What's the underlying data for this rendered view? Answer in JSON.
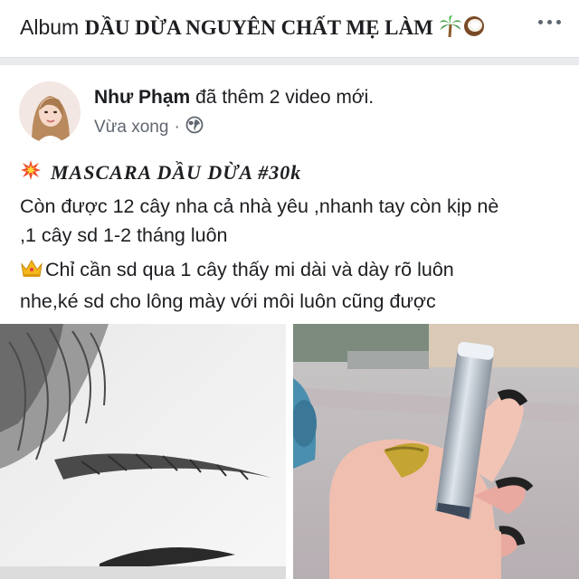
{
  "header": {
    "album_prefix": "Album",
    "album_name": "DẦU DỪA NGUYÊN CHẤT MẸ LÀM",
    "emoji_icons": [
      "palm-tree-icon",
      "coconut-icon"
    ],
    "more_icon": "more-horizontal-icon"
  },
  "post": {
    "author_name": "Như Phạm",
    "action": "đã thêm 2 video mới.",
    "time": "Vừa xong",
    "separator": "·",
    "privacy_icon": "globe-icon",
    "title": "MASCARA DẦU DỪA #30k",
    "title_icon": "collision-icon",
    "paragraph1_line1": "Còn được 12 cây nha cả nhà yêu ,nhanh tay còn kịp nè",
    "paragraph1_line2": ",1 cây sd 1-2 tháng luôn",
    "paragraph2_line1": "Chỉ cần sd qua 1 cây thấy mi dài và dày rõ luôn",
    "paragraph2_line2": "nhe,ké sd cho lông mày với môi luôn cũng được",
    "paragraph2_icon": "crown-icon",
    "media": [
      "eyebrow-video-thumbnail",
      "mascara-hand-video-thumbnail"
    ]
  },
  "colors": {
    "background": "#e9ebee",
    "card": "#ffffff",
    "text": "#1c1e21",
    "secondary_text": "#606770"
  }
}
